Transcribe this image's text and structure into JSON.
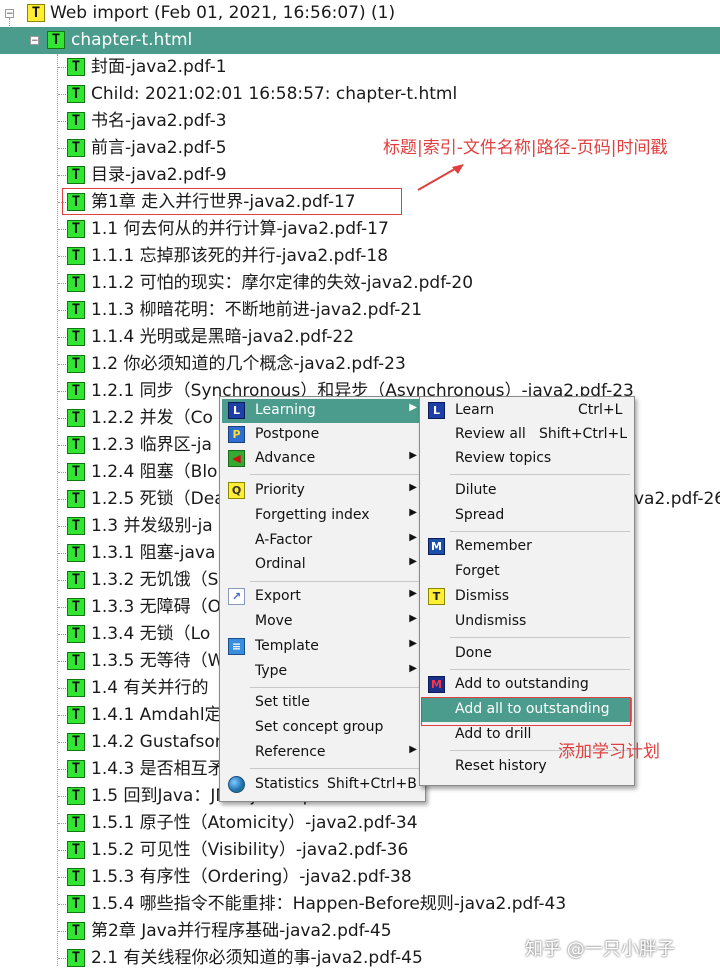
{
  "tree": {
    "root_label": "Web import (Feb 01, 2021, 16:56:07) (1)",
    "selected_label": "chapter-t.html",
    "items": [
      "封面-java2.pdf-1",
      "Child: 2021:02:01 16:58:57: chapter-t.html",
      "书名-java2.pdf-3",
      "前言-java2.pdf-5",
      "目录-java2.pdf-9",
      "第1章 走入并行世界-java2.pdf-17",
      "1.1 何去何从的并行计算-java2.pdf-17",
      "1.1.1 忘掉那该死的并行-java2.pdf-18",
      "1.1.2 可怕的现实：摩尔定律的失效-java2.pdf-20",
      "1.1.3 柳暗花明：不断地前进-java2.pdf-21",
      "1.1.4 光明或是黑暗-java2.pdf-22",
      "1.2 你必须知道的几个概念-java2.pdf-23",
      "1.2.1 同步（Synchronous）和异步（Asynchronous）-java2.pdf-23",
      "1.2.2 并发（Co",
      "1.2.3 临界区-ja",
      "1.2.4 阻塞（Blo",
      "1.2.5 死锁（Dea",
      "1.3 并发级别-ja",
      "1.3.1 阻塞-java",
      "1.3.2 无饥饿（S",
      "1.3.3 无障碍（O",
      "1.3.4 无锁（Lo",
      "1.3.5 无等待（W",
      "1.4 有关并行的",
      "1.4.1 Amdahl定",
      "1.4.2 Gustafson",
      "1.4.3 是否相互矛",
      "1.5 回到Java：JMM-java2.pdf-34",
      "1.5.1 原子性（Atomicity）-java2.pdf-34",
      "1.5.2 可见性（Visibility）-java2.pdf-36",
      "1.5.3 有序性（Ordering）-java2.pdf-38",
      "1.5.4 哪些指令不能重排：Happen-Before规则-java2.pdf-43",
      "第2章 Java并行程序基础-java2.pdf-45",
      "2.1 有关线程你必须知道的事-java2.pdf-45"
    ],
    "overflow_fragment": "va2.pdf-26"
  },
  "annotations": {
    "title_note": "标题|索引-文件名称|路径-页码|时间戳",
    "plan_note": "添加学习计划"
  },
  "context_menu": {
    "items": [
      {
        "label": "Learning",
        "icon": "learning-icon",
        "submenu": true,
        "highlighted": true
      },
      {
        "label": "Postpone",
        "icon": "postpone-icon",
        "submenu": false
      },
      {
        "label": "Advance",
        "icon": "advance-icon",
        "submenu": true
      },
      {
        "label": "Priority",
        "icon": "priority-icon",
        "submenu": true
      },
      {
        "label": "Forgetting index",
        "submenu": true
      },
      {
        "label": "A-Factor",
        "submenu": true
      },
      {
        "label": "Ordinal",
        "submenu": true
      },
      {
        "label": "Export",
        "icon": "export-icon",
        "submenu": true
      },
      {
        "label": "Move",
        "submenu": true
      },
      {
        "label": "Template",
        "icon": "template-icon",
        "submenu": true
      },
      {
        "label": "Type",
        "submenu": true
      },
      {
        "label": "Set title",
        "submenu": false
      },
      {
        "label": "Set concept group",
        "submenu": false
      },
      {
        "label": "Reference",
        "submenu": true
      },
      {
        "label": "Statistics",
        "icon": "statistics-icon",
        "shortcut": "Shift+Ctrl+B"
      }
    ]
  },
  "submenu": {
    "items": [
      {
        "label": "Learn",
        "shortcut": "Ctrl+L",
        "icon": "learn-icon"
      },
      {
        "label": "Review all",
        "shortcut": "Shift+Ctrl+L"
      },
      {
        "label": "Review topics"
      },
      {
        "label": "Dilute"
      },
      {
        "label": "Spread"
      },
      {
        "label": "Remember",
        "icon": "remember-icon"
      },
      {
        "label": "Forget"
      },
      {
        "label": "Dismiss",
        "icon": "dismiss-icon"
      },
      {
        "label": "Undismiss"
      },
      {
        "label": "Done"
      },
      {
        "label": "Add to outstanding",
        "icon": "outstanding-icon"
      },
      {
        "label": "Add all to outstanding",
        "highlighted": true
      },
      {
        "label": "Add to drill"
      },
      {
        "label": "Reset history"
      }
    ]
  },
  "watermark": "知乎 @一只小胖子",
  "colors": {
    "selection": "#4c9c8e",
    "annotation_red": "#e04040",
    "node_icon_green": "#33e533",
    "node_icon_yellow": "#ffee33"
  }
}
